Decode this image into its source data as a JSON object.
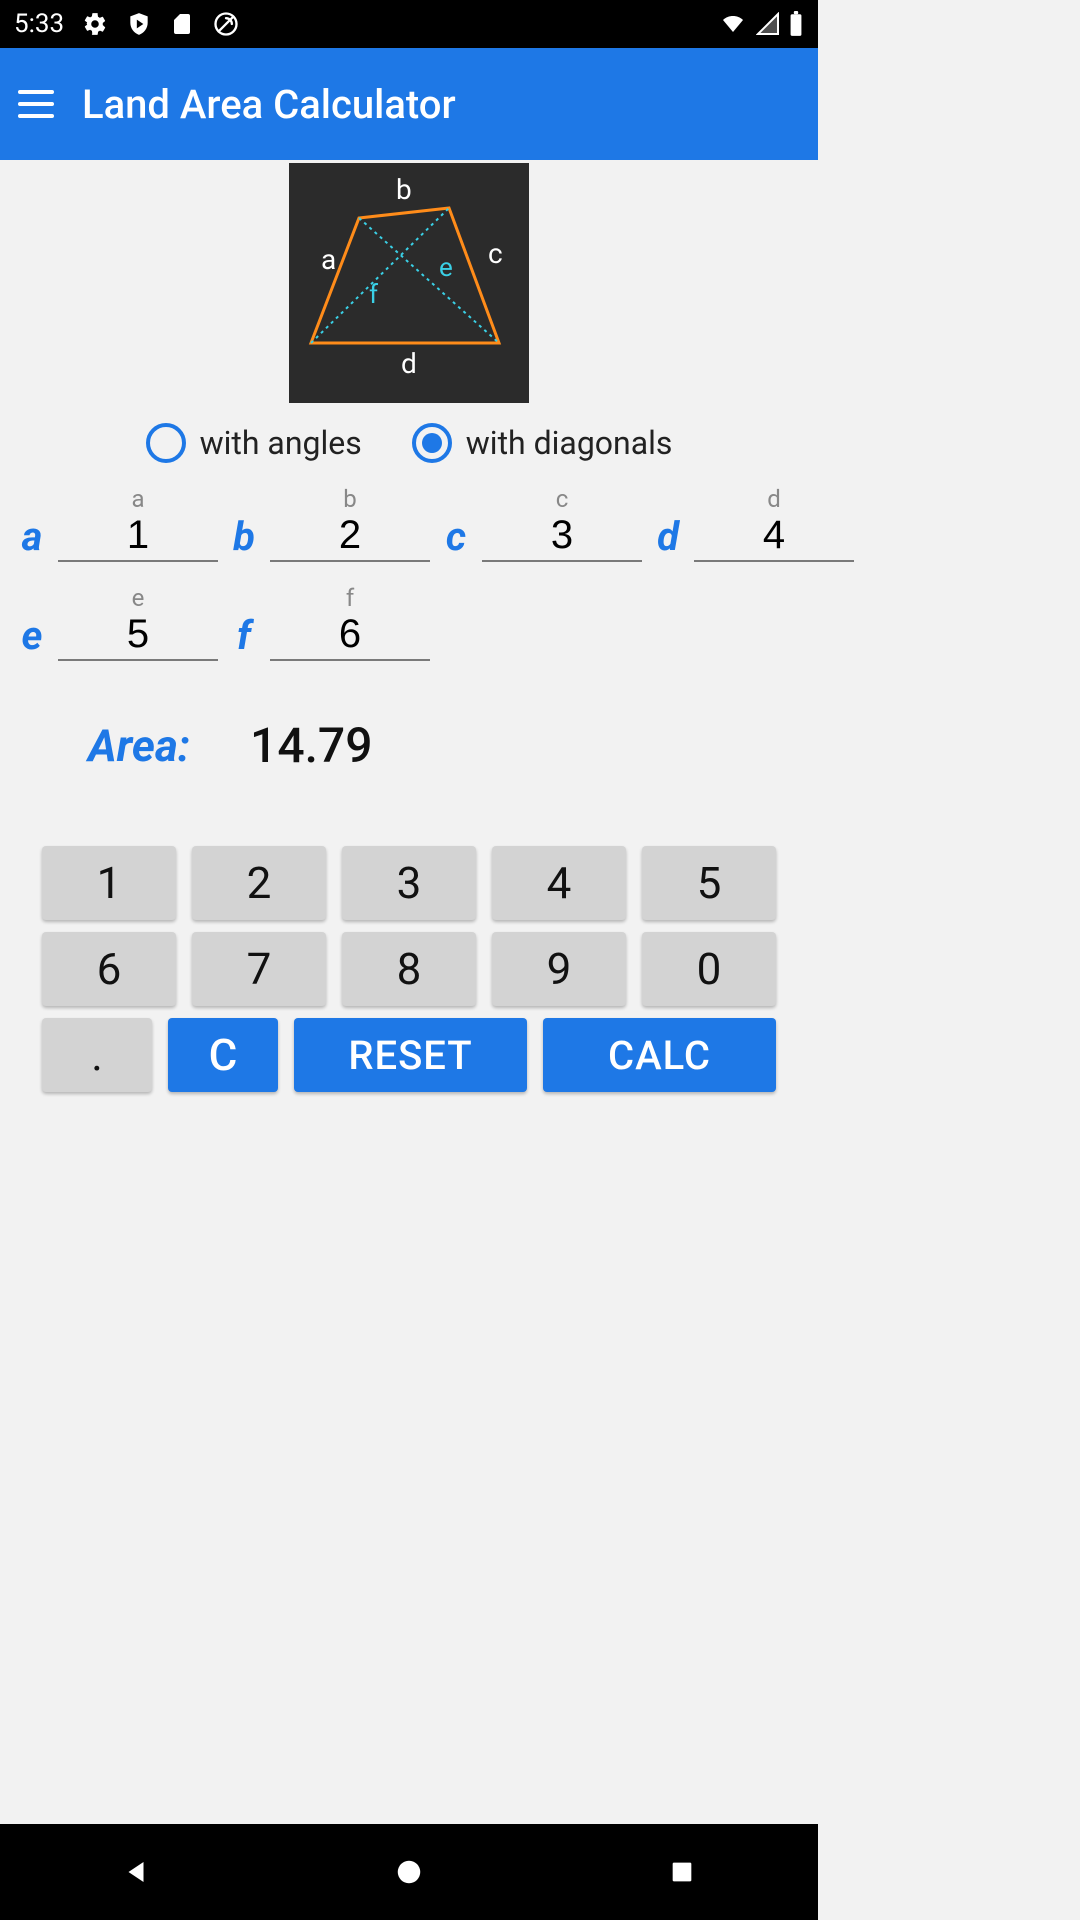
{
  "status_bar": {
    "time": "5:33"
  },
  "app_bar": {
    "title": "Land Area Calculator"
  },
  "diagram": {
    "labels": {
      "a": "a",
      "b": "b",
      "c": "c",
      "d": "d",
      "e": "e",
      "f": "f"
    }
  },
  "radio": {
    "with_angles": "with angles",
    "with_diagonals": "with diagonals",
    "selected": "with_diagonals"
  },
  "fields": {
    "a": {
      "label": "a",
      "hint": "a",
      "value": "1"
    },
    "b": {
      "label": "b",
      "hint": "b",
      "value": "2"
    },
    "c": {
      "label": "c",
      "hint": "c",
      "value": "3"
    },
    "d": {
      "label": "d",
      "hint": "d",
      "value": "4"
    },
    "e": {
      "label": "e",
      "hint": "e",
      "value": "5"
    },
    "f": {
      "label": "f",
      "hint": "f",
      "value": "6"
    }
  },
  "area": {
    "label": "Area:",
    "value": "14.79"
  },
  "keypad": {
    "n1": "1",
    "n2": "2",
    "n3": "3",
    "n4": "4",
    "n5": "5",
    "n6": "6",
    "n7": "7",
    "n8": "8",
    "n9": "9",
    "n0": "0",
    "dot": ".",
    "clear": "C",
    "reset": "RESET",
    "calc": "CALC"
  },
  "colors": {
    "primary": "#1e78e6",
    "accent_orange": "#ff8c1a",
    "accent_cyan": "#3ad0e6"
  }
}
